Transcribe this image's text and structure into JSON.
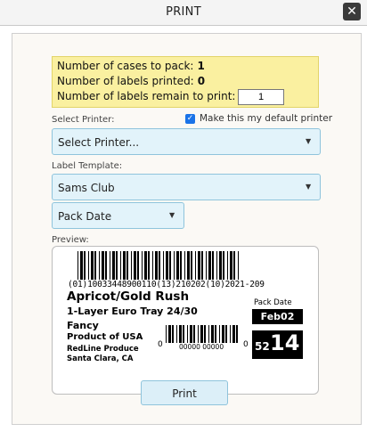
{
  "window": {
    "title": "PRINT",
    "close_icon": "close-icon"
  },
  "summary": {
    "cases_label": "Number of cases to pack:",
    "cases_value": "1",
    "printed_label": "Number of labels printed:",
    "printed_value": "0",
    "remain_label": "Number of labels remain to print:",
    "remain_value": "1"
  },
  "printer": {
    "label": "Select Printer:",
    "default_checkbox_label": "Make this my default printer",
    "default_checked": true,
    "selected": "Select Printer..."
  },
  "template": {
    "label": "Label Template:",
    "selected": "Sams Club",
    "date_type": "Pack Date"
  },
  "preview": {
    "label": "Preview:",
    "barcode_text": "(01)10033448900110(13)210202(10)2021-209",
    "product_name": "Apricot/Gold Rush",
    "pack_desc": "1-Layer Euro Tray 24/30",
    "grade": "Fancy",
    "origin": "Product of USA",
    "company": "RedLine Produce",
    "location": "Santa Clara, CA",
    "upc_left": "0",
    "upc_middle": "00000 00000",
    "upc_right": "0",
    "pack_date_label": "Pack Date",
    "pack_date": "Feb02",
    "week": "52",
    "day": "14"
  },
  "actions": {
    "print_label": "Print"
  }
}
